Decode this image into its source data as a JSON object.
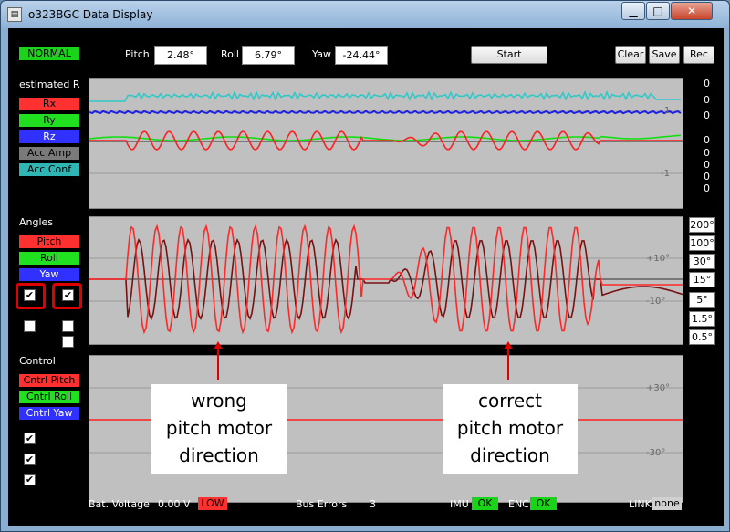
{
  "window": {
    "title": "o323BGC Data Display",
    "icon": "app-icon",
    "min": "▁",
    "max": "□",
    "close": "✕"
  },
  "status": {
    "mode": "NORMAL",
    "mode_color": "#19d419"
  },
  "readouts": {
    "pitch_label": "Pitch",
    "pitch_value": "2.48°",
    "roll_label": "Roll",
    "roll_value": "6.79°",
    "yaw_label": "Yaw",
    "yaw_value": "-24.44°"
  },
  "buttons": {
    "start": "Start",
    "clear": "Clear",
    "save": "Save",
    "rec": "Rec"
  },
  "estimated": {
    "title": "estimated R",
    "items": [
      {
        "label": "Rx",
        "color": "#ff3030"
      },
      {
        "label": "Ry",
        "color": "#20e020"
      },
      {
        "label": "Rz",
        "color": "#3030ff"
      },
      {
        "label": "Acc Amp",
        "color": "#7a7a7a"
      },
      {
        "label": "Acc Conf",
        "color": "#30b5b5"
      }
    ],
    "right_values": [
      "0",
      "0",
      "0",
      "0",
      "0",
      "0",
      "0",
      "0"
    ],
    "axis_labels": [
      "1",
      "-1"
    ]
  },
  "angles": {
    "title": "Angles",
    "items": [
      {
        "label": "Pitch",
        "color": "#ff3030"
      },
      {
        "label": "Roll",
        "color": "#20e020"
      },
      {
        "label": "Yaw",
        "color": "#3030ff"
      }
    ],
    "axis_labels": [
      "+10°",
      "-10°"
    ],
    "scales": [
      "200°",
      "100°",
      "30°",
      "15°",
      "5°",
      "1.5°",
      "0.5°"
    ]
  },
  "control": {
    "title": "Control",
    "items": [
      {
        "label": "Cntrl Pitch",
        "color": "#ff3030"
      },
      {
        "label": "Cntrl Roll",
        "color": "#20e020"
      },
      {
        "label": "Cntrl Yaw",
        "color": "#3030ff"
      }
    ],
    "axis_labels": [
      "+30°",
      "-30°"
    ]
  },
  "callouts": {
    "wrong": [
      "wrong",
      "pitch motor",
      "direction"
    ],
    "correct": [
      "correct",
      "pitch motor",
      "direction"
    ]
  },
  "bottom": {
    "bat_label": "Bat. Voltage",
    "bat_value": "0.00 V",
    "bat_status": "LOW",
    "bus_label": "Bus Errors",
    "bus_value": "3",
    "imu_label": "IMU",
    "imu_status": "OK",
    "enc_label": "ENC",
    "enc_status": "OK",
    "link_label": "LINK",
    "link_status": "none"
  }
}
